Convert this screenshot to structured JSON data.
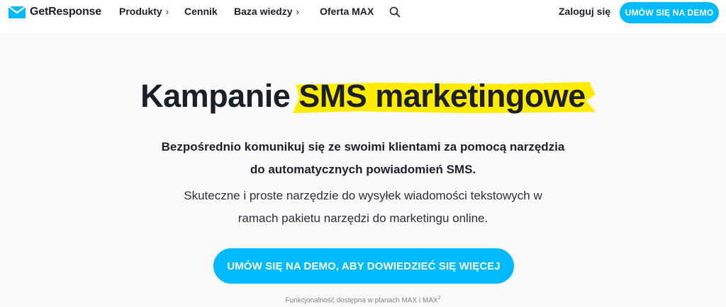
{
  "brand": {
    "name": "GetResponse",
    "accent": "#00baff",
    "highlight": "#ffec00"
  },
  "nav": {
    "items": [
      {
        "label": "Produkty",
        "chevron": "›"
      },
      {
        "label": "Cennik"
      },
      {
        "label": "Baza wiedzy",
        "chevron": "›"
      },
      {
        "label": "Oferta MAX"
      }
    ],
    "search_icon": "search-icon",
    "login": "Zaloguj się",
    "demo_button": "UMÓW SIĘ NA DEMO"
  },
  "hero": {
    "title_plain": "Kampanie ",
    "title_highlight": "SMS marketingowe",
    "lead_line1": "Bezpośrednio komunikuj się ze swoimi klientami za pomocą narzędzia",
    "lead_line2": "do automatycznych powiadomień SMS.",
    "sub_line1": "Skuteczne i proste narzędzie do wysyłek wiadomości tekstowych w",
    "sub_line2": "ramach pakietu narzędzi do marketingu online.",
    "cta": "UMÓW SIĘ NA DEMO, ABY DOWIEDZIEĆ SIĘ WIĘCEJ",
    "note": "Funkcjonalność dostępna w planach MAX i MAX",
    "note_sup": "2"
  }
}
